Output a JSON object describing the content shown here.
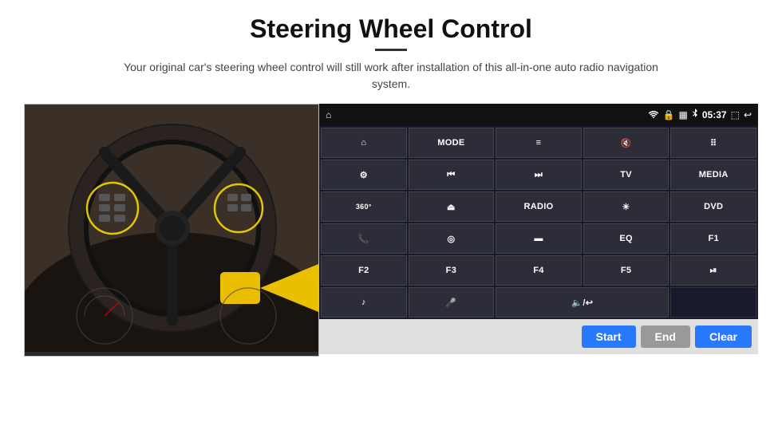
{
  "page": {
    "title": "Steering Wheel Control",
    "subtitle": "Your original car's steering wheel control will still work after installation of this all-in-one auto radio navigation system."
  },
  "statusBar": {
    "time": "05:37",
    "icons": [
      "wifi",
      "lock",
      "sim",
      "bluetooth",
      "cast",
      "back"
    ]
  },
  "buttonGrid": [
    {
      "id": "r1c1",
      "label": "▲",
      "type": "icon",
      "icon": "home"
    },
    {
      "id": "r1c2",
      "label": "MODE",
      "type": "text"
    },
    {
      "id": "r1c3",
      "label": "≡",
      "type": "icon"
    },
    {
      "id": "r1c4",
      "label": "🔇",
      "type": "icon"
    },
    {
      "id": "r1c5",
      "label": "⠿",
      "type": "icon"
    },
    {
      "id": "r2c1",
      "label": "⊙",
      "type": "icon"
    },
    {
      "id": "r2c2",
      "label": "⏮",
      "type": "icon"
    },
    {
      "id": "r2c3",
      "label": "⏭",
      "type": "icon"
    },
    {
      "id": "r2c4",
      "label": "TV",
      "type": "text"
    },
    {
      "id": "r2c5",
      "label": "MEDIA",
      "type": "text"
    },
    {
      "id": "r3c1",
      "label": "360",
      "type": "text-small"
    },
    {
      "id": "r3c2",
      "label": "▲",
      "type": "icon"
    },
    {
      "id": "r3c3",
      "label": "RADIO",
      "type": "text"
    },
    {
      "id": "r3c4",
      "label": "☀",
      "type": "icon"
    },
    {
      "id": "r3c5",
      "label": "DVD",
      "type": "text"
    },
    {
      "id": "r4c1",
      "label": "📞",
      "type": "icon"
    },
    {
      "id": "r4c2",
      "label": "◎",
      "type": "icon"
    },
    {
      "id": "r4c3",
      "label": "▬",
      "type": "icon"
    },
    {
      "id": "r4c4",
      "label": "EQ",
      "type": "text"
    },
    {
      "id": "r4c5",
      "label": "F1",
      "type": "text"
    },
    {
      "id": "r5c1",
      "label": "F2",
      "type": "text"
    },
    {
      "id": "r5c2",
      "label": "F3",
      "type": "text"
    },
    {
      "id": "r5c3",
      "label": "F4",
      "type": "text"
    },
    {
      "id": "r5c4",
      "label": "F5",
      "type": "text"
    },
    {
      "id": "r5c5",
      "label": "⏯",
      "type": "icon"
    },
    {
      "id": "r6c1",
      "label": "♪",
      "type": "icon"
    },
    {
      "id": "r6c2",
      "label": "🎤",
      "type": "icon"
    },
    {
      "id": "r6c3",
      "label": "🔈",
      "type": "icon",
      "wide": true
    },
    {
      "id": "r6c4",
      "label": "",
      "type": "empty"
    },
    {
      "id": "r6c5",
      "label": "",
      "type": "empty"
    }
  ],
  "actionBar": {
    "startLabel": "Start",
    "endLabel": "End",
    "clearLabel": "Clear"
  }
}
